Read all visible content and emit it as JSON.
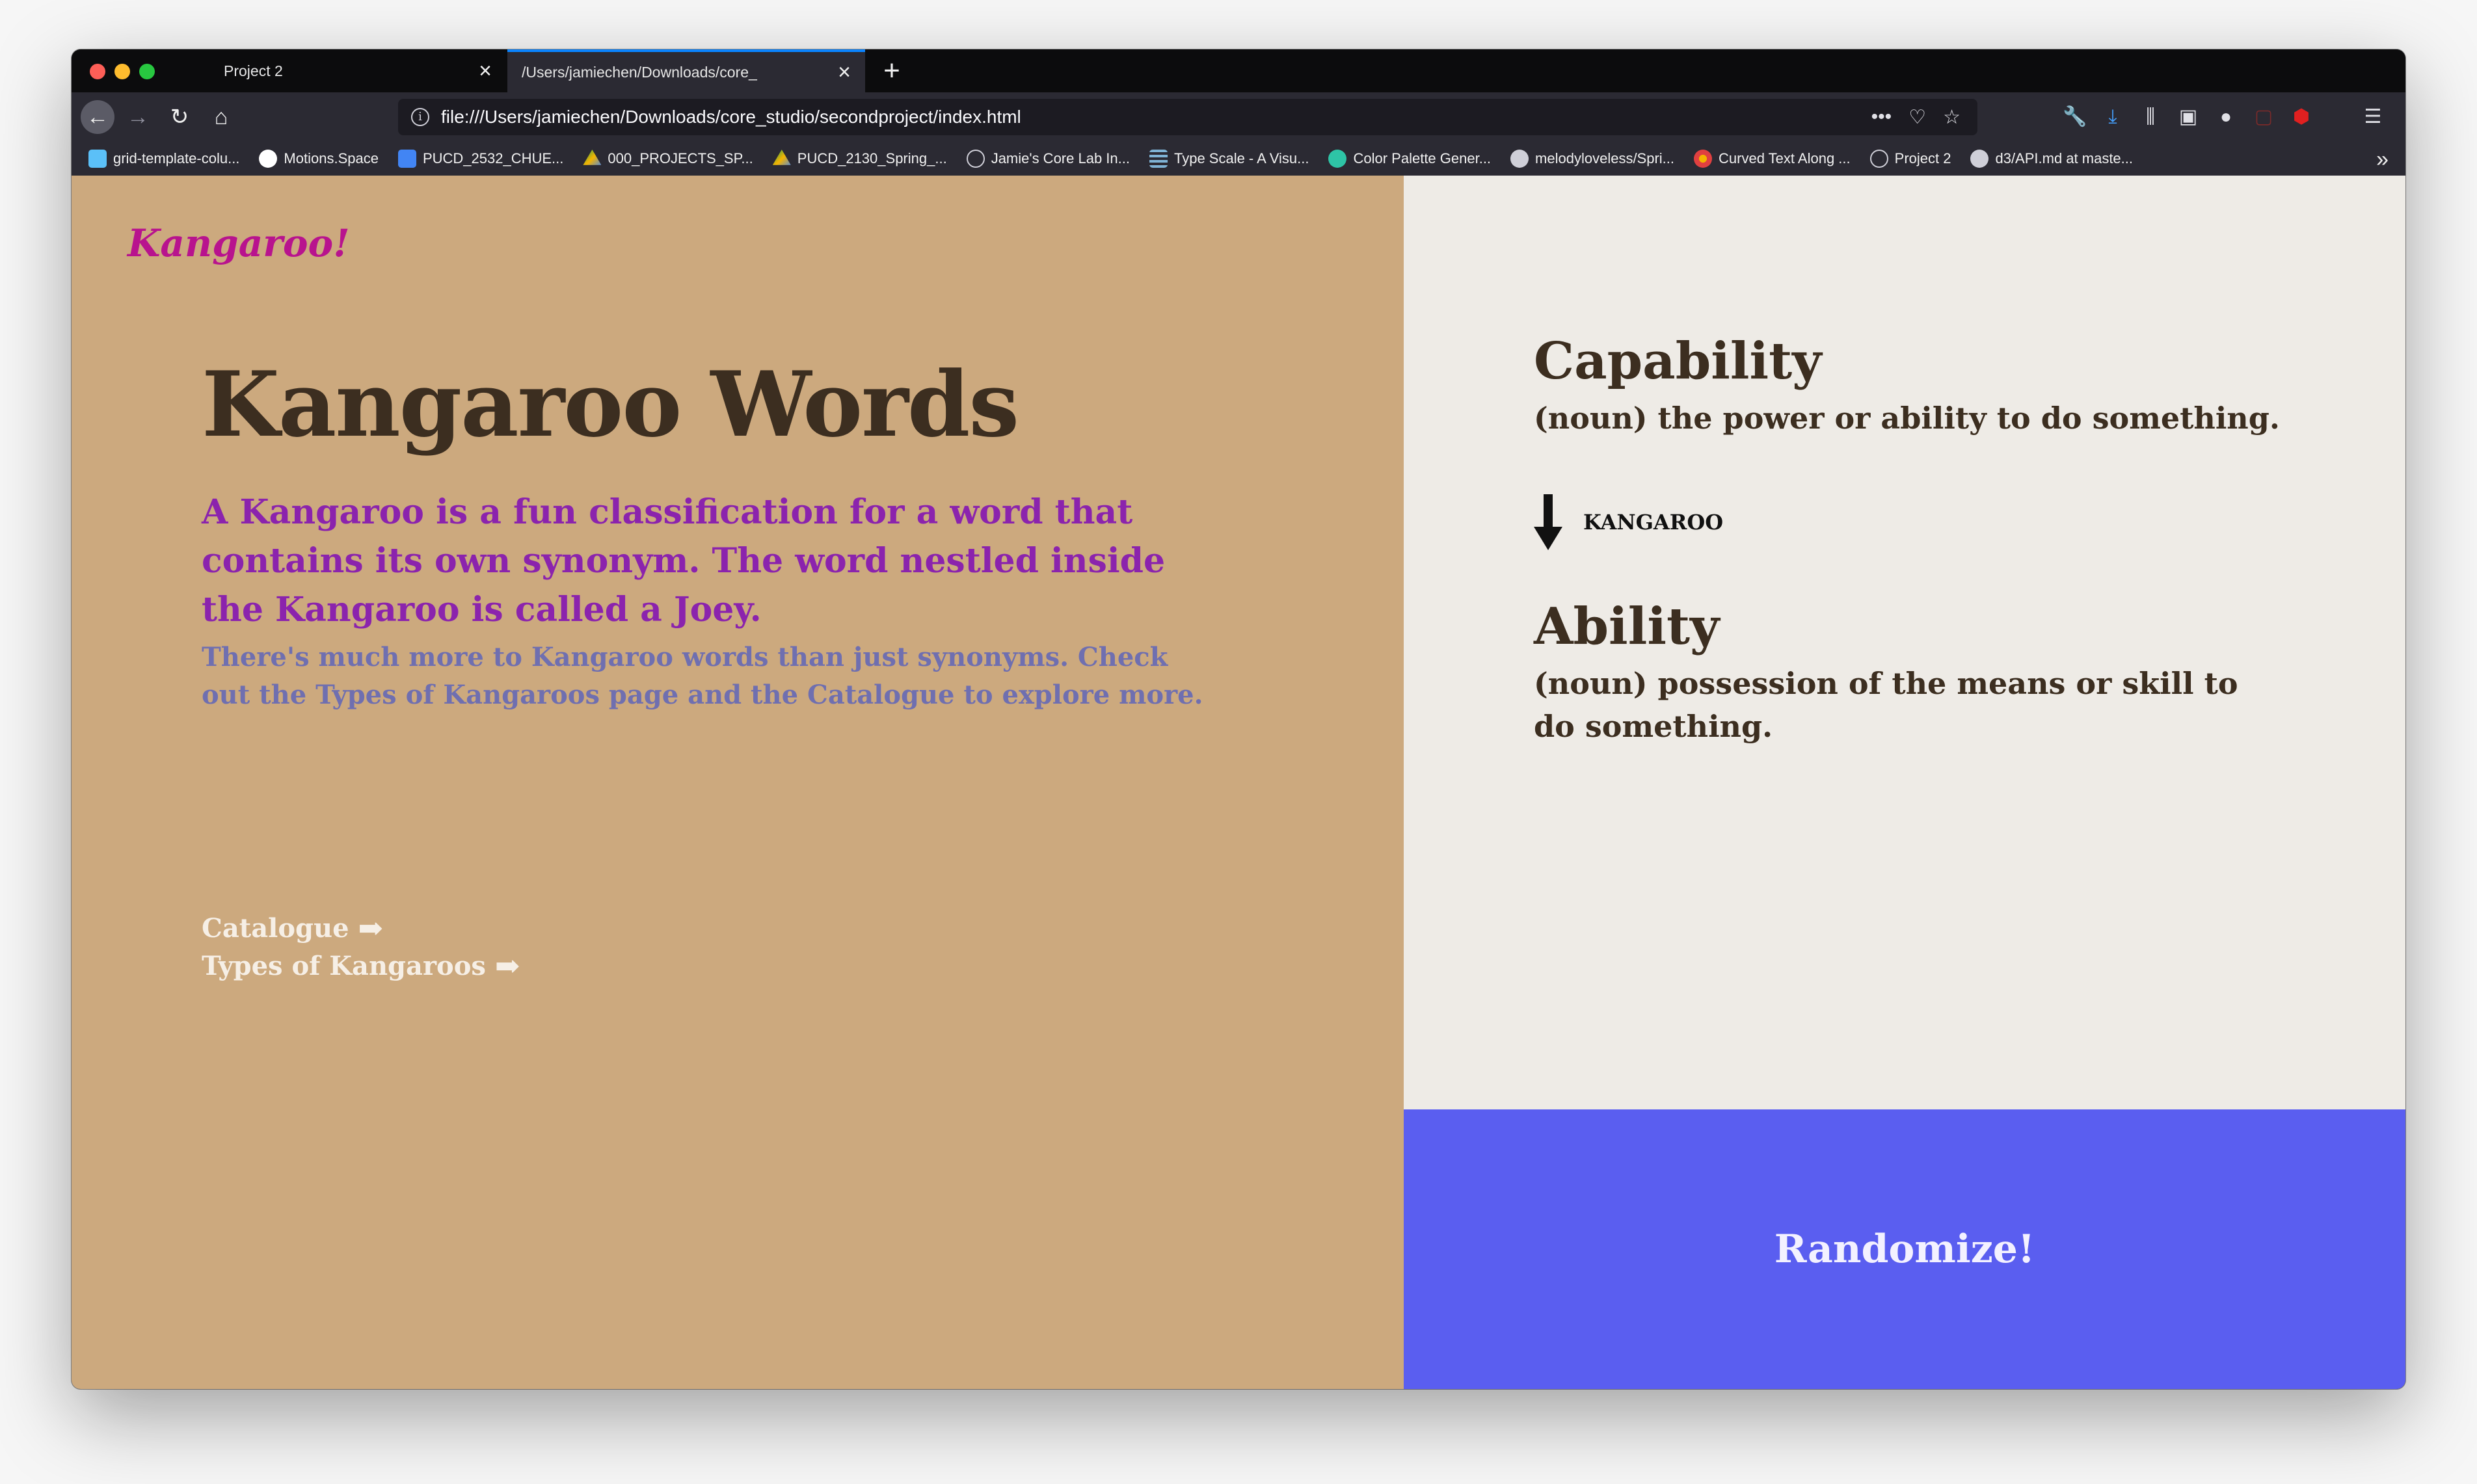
{
  "browser": {
    "tabs": [
      {
        "label": "Project 2"
      },
      {
        "label": "/Users/jamiechen/Downloads/core_"
      }
    ],
    "new_tab_label": "+",
    "url": "file:///Users/jamiechen/Downloads/core_studio/secondproject/index.html",
    "bookmarks": [
      {
        "label": "grid-template-colu...",
        "icon": "bookmark-favicon",
        "color": "#5bc0f8"
      },
      {
        "label": "Motions.Space",
        "icon": "circle-favicon",
        "color": "#ffffff"
      },
      {
        "label": "PUCD_2532_CHUE...",
        "icon": "docs-favicon",
        "color": "#4285f4"
      },
      {
        "label": "000_PROJECTS_SP...",
        "icon": "drive-favicon",
        "color": "#f4b400"
      },
      {
        "label": "PUCD_2130_Spring_...",
        "icon": "drive-favicon",
        "color": "#0f9d58"
      },
      {
        "label": "Jamie's Core Lab In...",
        "icon": "globe-favicon",
        "color": "#cfcfd8"
      },
      {
        "label": "Type Scale - A Visu...",
        "icon": "typescale-favicon",
        "color": "#7fb3d5"
      },
      {
        "label": "Color Palette Gener...",
        "icon": "palette-favicon",
        "color": "#2ec4a6"
      },
      {
        "label": "melodyloveless/Spri...",
        "icon": "github-favicon",
        "color": "#cfcfd8"
      },
      {
        "label": "Curved Text Along ...",
        "icon": "curved-favicon",
        "color": "#e04040"
      },
      {
        "label": "Project 2",
        "icon": "globe-favicon",
        "color": "#cfcfd8"
      },
      {
        "label": "d3/API.md at maste...",
        "icon": "github-favicon",
        "color": "#cfcfd8"
      }
    ]
  },
  "page": {
    "logo": "Kangaroo!",
    "title": "Kangaroo Words",
    "lead": "A Kangaroo is a fun classification for a word that contains its own synonym. The word nestled inside the Kangaroo is called a Joey.",
    "sub": "There's much more to Kangaroo words than just synonyms. Check out the Types of Kangaroos page and the Catalogue to explore more.",
    "links": [
      {
        "label": "Catalogue",
        "arrow": "➡"
      },
      {
        "label": "Types of Kangaroos",
        "arrow": "➡"
      }
    ],
    "kangaroo_word": {
      "title": "Capability",
      "definition": "(noun) the power or ability to do something."
    },
    "relation_label": "KANGAROO",
    "joey_word": {
      "title": "Ability",
      "definition": "(noun) possession of the means or skill to do something."
    },
    "randomize_label": "Randomize!"
  },
  "colors": {
    "left_bg": "#cca97e",
    "right_bg": "#eeebe6",
    "randomize_bg": "#5a5ef0",
    "logo": "#b8138e",
    "lead": "#8b23ad",
    "sub": "#6f6fb0",
    "heading": "#3c2e20"
  }
}
